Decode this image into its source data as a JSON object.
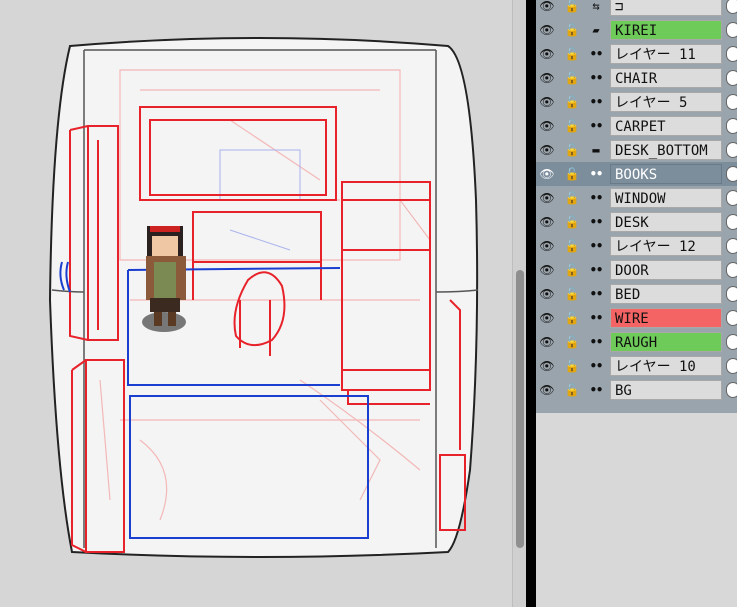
{
  "colors": {
    "wire_red": "#e8222a",
    "wire_blue": "#1a3fd0",
    "sketch_pink": "#f3b8b8",
    "label_green": "#6ecb5a",
    "label_red": "#f56464",
    "selected": "#7c8d9c"
  },
  "canvas": {
    "description_icon": "pixel-character-icon"
  },
  "layers": [
    {
      "name": "",
      "kind": "header",
      "highlight": "none",
      "selected": false
    },
    {
      "name": "KIREI",
      "kind": "folder",
      "highlight": "green",
      "selected": false
    },
    {
      "name": "レイヤー 11",
      "kind": "layer",
      "highlight": "none",
      "selected": false
    },
    {
      "name": "CHAIR",
      "kind": "layer",
      "highlight": "none",
      "selected": false
    },
    {
      "name": "レイヤー 5",
      "kind": "layer",
      "highlight": "none",
      "selected": false
    },
    {
      "name": "CARPET",
      "kind": "layer",
      "highlight": "none",
      "selected": false
    },
    {
      "name": "DESK_BOTTOM",
      "kind": "layer-mask",
      "highlight": "none",
      "selected": false
    },
    {
      "name": "BOOKS",
      "kind": "layer",
      "highlight": "none",
      "selected": true
    },
    {
      "name": "WINDOW",
      "kind": "layer",
      "highlight": "none",
      "selected": false
    },
    {
      "name": "DESK",
      "kind": "layer",
      "highlight": "none",
      "selected": false
    },
    {
      "name": "レイヤー 12",
      "kind": "layer",
      "highlight": "none",
      "selected": false
    },
    {
      "name": "DOOR",
      "kind": "layer",
      "highlight": "none",
      "selected": false
    },
    {
      "name": "BED",
      "kind": "layer",
      "highlight": "none",
      "selected": false
    },
    {
      "name": "WIRE",
      "kind": "layer",
      "highlight": "red",
      "selected": false
    },
    {
      "name": "RAUGH",
      "kind": "layer",
      "highlight": "green",
      "selected": false
    },
    {
      "name": "レイヤー 10",
      "kind": "layer",
      "highlight": "none",
      "selected": false
    },
    {
      "name": "BG",
      "kind": "layer",
      "highlight": "none",
      "selected": false
    }
  ]
}
